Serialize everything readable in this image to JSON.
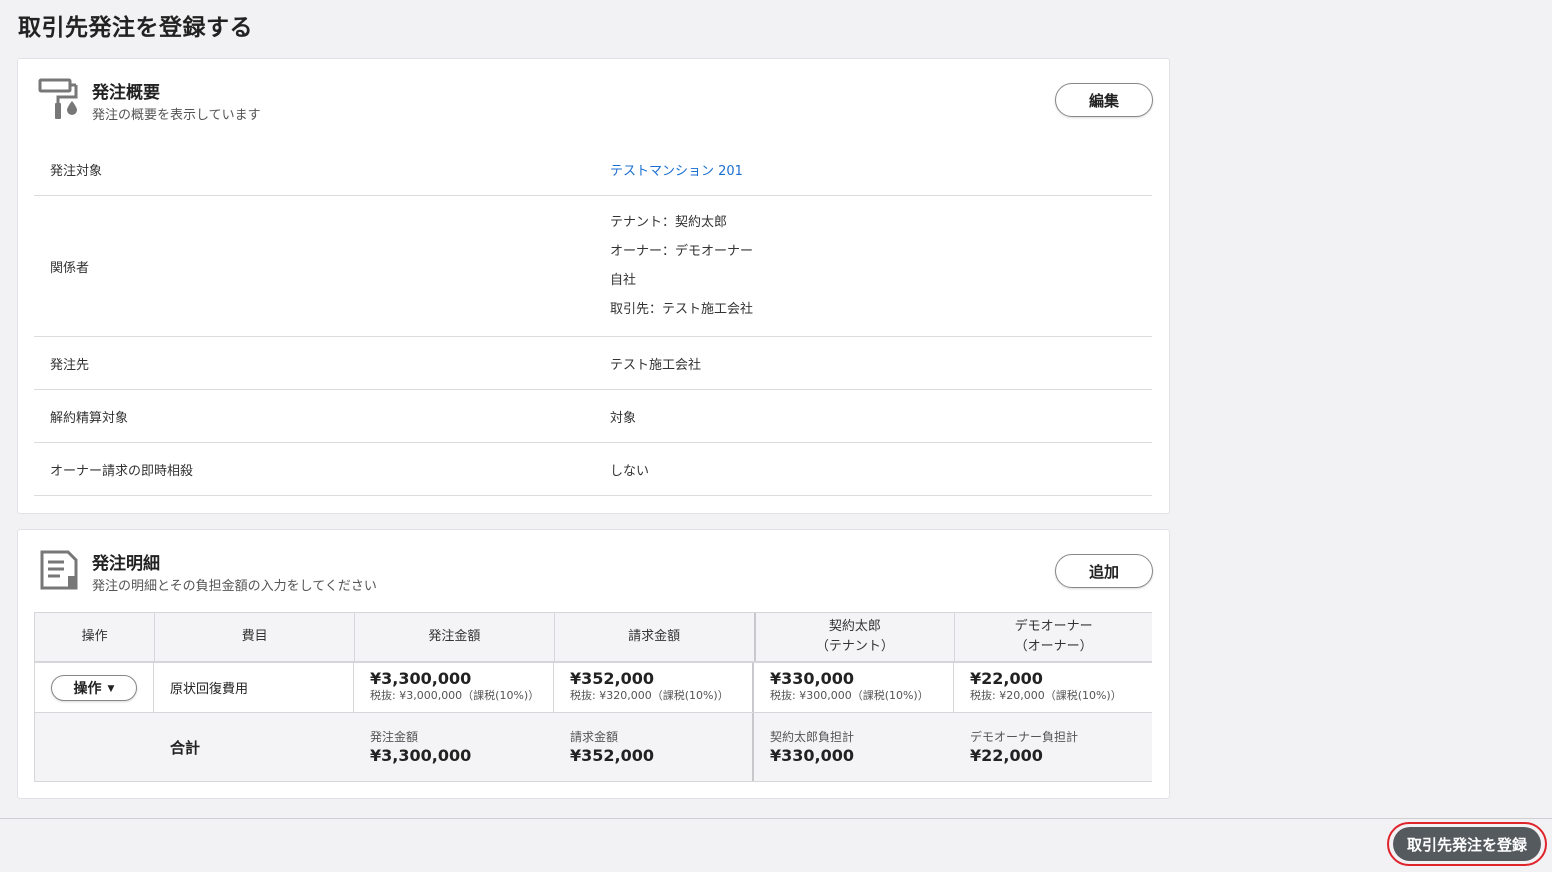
{
  "page_title": "取引先発注を登録する",
  "summary": {
    "title": "発注概要",
    "subtitle": "発注の概要を表示しています",
    "edit_label": "編集",
    "rows": [
      {
        "label": "発注対象",
        "value": "テストマンション 201"
      },
      {
        "label": "関係者",
        "parties": [
          "テナント：契約太郎",
          "オーナー：デモオーナー",
          "自社",
          "取引先：テスト施工会社"
        ]
      },
      {
        "label": "発注先",
        "value": "テスト施工会社"
      },
      {
        "label": "解約精算対象",
        "value": "対象"
      },
      {
        "label": "オーナー請求の即時相殺",
        "value": "しない"
      }
    ]
  },
  "detail": {
    "title": "発注明細",
    "subtitle": "発注の明細とその負担金額の入力をしてください",
    "add_label": "追加",
    "headers": {
      "op": "操作",
      "item": "費目",
      "order_amount": "発注金額",
      "bill_amount": "請求金額",
      "tenant_line1": "契約太郎",
      "tenant_line2": "（テナント）",
      "owner_line1": "デモオーナー",
      "owner_line2": "（オーナー）"
    },
    "row": {
      "op_label": "操作",
      "item": "原状回復費用",
      "order_amount": "¥3,300,000",
      "order_tax": "税抜: ¥3,000,000（課税(10%)）",
      "bill_amount": "¥352,000",
      "bill_tax": "税抜: ¥320,000（課税(10%)）",
      "tenant_amount": "¥330,000",
      "tenant_tax": "税抜: ¥300,000（課税(10%)）",
      "owner_amount": "¥22,000",
      "owner_tax": "税抜: ¥20,000（課税(10%)）"
    },
    "total": {
      "label": "合計",
      "order_label": "発注金額",
      "order_value": "¥3,300,000",
      "bill_label": "請求金額",
      "bill_value": "¥352,000",
      "tenant_label": "契約太郎負担計",
      "tenant_value": "¥330,000",
      "owner_label": "デモオーナー負担計",
      "owner_value": "¥22,000"
    }
  },
  "submit_label": "取引先発注を登録",
  "colors": {
    "link": "#1a6fd0",
    "submit_bg": "#555a5f",
    "highlight_ring": "#e0242b"
  }
}
